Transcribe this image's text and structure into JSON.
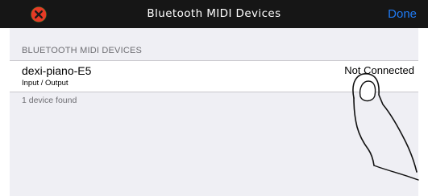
{
  "nav": {
    "close_icon": "x-circle-icon",
    "close_color": "#e63a25",
    "title": "Bluetooth MIDI Devices",
    "done_label": "Done",
    "done_color": "#1f7bf5",
    "bar_color": "#161616"
  },
  "list": {
    "section_header": "BLUETOOTH MIDI DEVICES",
    "devices": [
      {
        "name": "dexi-piano-E5",
        "subtitle": "Input / Output",
        "status": "Not Connected"
      }
    ],
    "footer": "1 device found"
  },
  "overlay": {
    "icon": "tap-finger-icon"
  }
}
